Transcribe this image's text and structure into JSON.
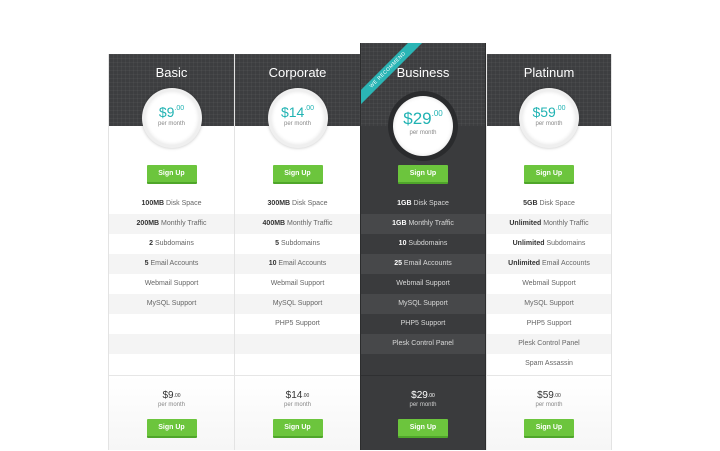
{
  "accent_color": "#21b3b3",
  "button_color": "#6cc53d",
  "plans": [
    {
      "name": "Basic",
      "currency": "$",
      "price": "9",
      "cents": ".00",
      "period": "per month",
      "signup": "Sign Up",
      "features": [
        {
          "b": "100MB",
          "t": " Disk Space"
        },
        {
          "b": "200MB",
          "t": " Monthly Traffic"
        },
        {
          "b": "2",
          "t": " Subdomains"
        },
        {
          "b": "5",
          "t": " Email Accounts"
        },
        {
          "b": "",
          "t": "Webmail Support"
        },
        {
          "b": "",
          "t": "MySQL Support"
        },
        {
          "b": "",
          "t": ""
        },
        {
          "b": "",
          "t": ""
        },
        {
          "b": "",
          "t": ""
        }
      ]
    },
    {
      "name": "Corporate",
      "currency": "$",
      "price": "14",
      "cents": ".00",
      "period": "per month",
      "signup": "Sign Up",
      "features": [
        {
          "b": "300MB",
          "t": " Disk Space"
        },
        {
          "b": "400MB",
          "t": " Monthly Traffic"
        },
        {
          "b": "5",
          "t": " Subdomains"
        },
        {
          "b": "10",
          "t": " Email Accounts"
        },
        {
          "b": "",
          "t": "Webmail Support"
        },
        {
          "b": "",
          "t": "MySQL Support"
        },
        {
          "b": "",
          "t": "PHP5 Support"
        },
        {
          "b": "",
          "t": ""
        },
        {
          "b": "",
          "t": ""
        }
      ]
    },
    {
      "name": "Business",
      "ribbon": "WE RECOMMEND",
      "currency": "$",
      "price": "29",
      "cents": ".00",
      "period": "per month",
      "signup": "Sign Up",
      "features": [
        {
          "b": "1GB",
          "t": " Disk Space"
        },
        {
          "b": "1GB",
          "t": " Monthly Traffic"
        },
        {
          "b": "10",
          "t": " Subdomains"
        },
        {
          "b": "25",
          "t": " Email Accounts"
        },
        {
          "b": "",
          "t": "Webmail Support"
        },
        {
          "b": "",
          "t": "MySQL Support"
        },
        {
          "b": "",
          "t": "PHP5 Support"
        },
        {
          "b": "",
          "t": "Plesk Control Panel"
        },
        {
          "b": "",
          "t": ""
        }
      ]
    },
    {
      "name": "Platinum",
      "currency": "$",
      "price": "59",
      "cents": ".00",
      "period": "per month",
      "signup": "Sign Up",
      "features": [
        {
          "b": "5GB",
          "t": " Disk Space"
        },
        {
          "b": "Unlimited",
          "t": " Monthly Traffic"
        },
        {
          "b": "Unlimited",
          "t": " Subdomains"
        },
        {
          "b": "Unlimited",
          "t": " Email Accounts"
        },
        {
          "b": "",
          "t": "Webmail Support"
        },
        {
          "b": "",
          "t": "MySQL Support"
        },
        {
          "b": "",
          "t": "PHP5 Support"
        },
        {
          "b": "",
          "t": "Plesk Control Panel"
        },
        {
          "b": "",
          "t": "Spam Assassin"
        }
      ]
    }
  ]
}
